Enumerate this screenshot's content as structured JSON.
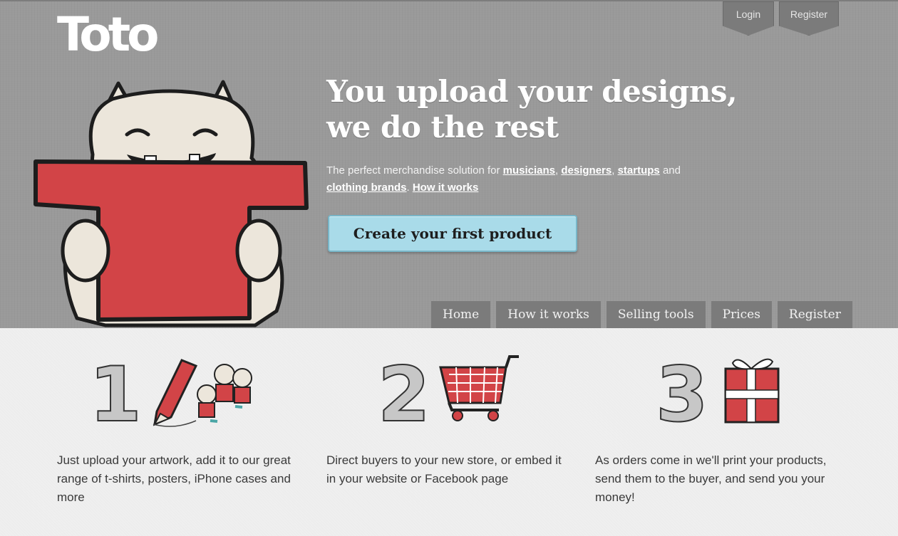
{
  "brand": {
    "logo": "Toto"
  },
  "top_tabs": {
    "login": "Login",
    "register": "Register"
  },
  "hero": {
    "headline_line1": "You upload your designs,",
    "headline_line2": "we do the rest",
    "sub_prefix": "The perfect merchandise solution for",
    "link_musicians": "musicians",
    "link_designers": "designers",
    "link_startups": "startups",
    "and": "and",
    "link_clothing": "clothing brands",
    "link_how": "How it works",
    "cta": "Create your first product"
  },
  "nav": [
    "Home",
    "How it works",
    "Selling tools",
    "Prices",
    "Register"
  ],
  "steps": [
    {
      "number": "1",
      "text": "Just upload your artwork, add it to our great range of t-shirts, posters, iPhone cases and more"
    },
    {
      "number": "2",
      "text": "Direct buyers to your new store, or embed it in your website or Facebook page"
    },
    {
      "number": "3",
      "text": "As orders come in we'll print your products, send them to the buyer, and send you your money!"
    }
  ],
  "colors": {
    "hero_bg": "#9a9a9a",
    "tab_bg": "#7b7b7b",
    "cta_bg": "#a9dbe9",
    "shirt_red": "#d24447",
    "monster_fur": "#ece6db"
  }
}
